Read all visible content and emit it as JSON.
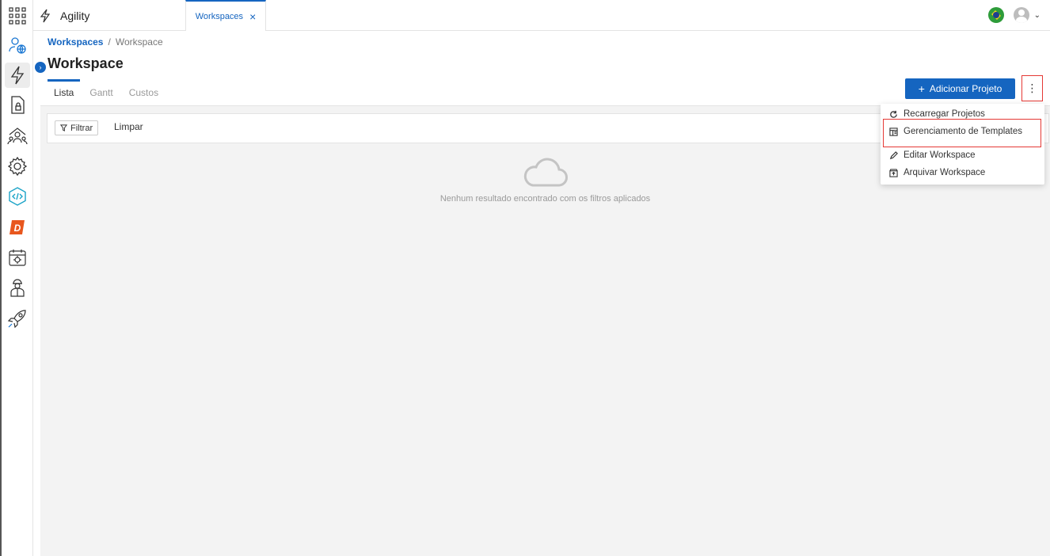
{
  "app": {
    "title": "Agility"
  },
  "topbar": {
    "tab_label": "Workspaces",
    "tab_close": "×",
    "user_chevron": "⌄"
  },
  "breadcrumb": {
    "root": "Workspaces",
    "separator": "/",
    "current": "Workspace"
  },
  "page": {
    "title": "Workspace",
    "collapse_glyph": "›"
  },
  "tabs": [
    {
      "label": "Lista"
    },
    {
      "label": "Gantt"
    },
    {
      "label": "Custos"
    }
  ],
  "actions": {
    "add_project": "Adicionar Projeto",
    "add_glyph": "+",
    "more_glyph": "⋮"
  },
  "filter": {
    "filter_label": "Filtrar",
    "clear_label": "Limpar"
  },
  "empty": {
    "message": "Nenhum resultado encontrado com os filtros aplicados"
  },
  "menu": {
    "items": [
      {
        "label": "Recarregar Projetos",
        "icon": "refresh-icon"
      },
      {
        "label": "Gerenciamento de Templates",
        "icon": "template-icon"
      },
      {
        "label": "Editar Workspace",
        "icon": "pencil-icon"
      },
      {
        "label": "Arquivar Workspace",
        "icon": "archive-icon"
      }
    ]
  },
  "sidebar": {
    "items": [
      {
        "icon": "apps-grid-icon"
      },
      {
        "icon": "user-globe-icon"
      },
      {
        "icon": "lightning-icon"
      },
      {
        "icon": "document-lock-icon"
      },
      {
        "icon": "team-icon"
      },
      {
        "icon": "settings-gear-icon"
      },
      {
        "icon": "code-hexagon-icon"
      },
      {
        "icon": "d-logo-icon"
      },
      {
        "icon": "calendar-gear-icon"
      },
      {
        "icon": "engineer-icon"
      },
      {
        "icon": "rocket-icon"
      }
    ]
  },
  "colors": {
    "accent": "#1565c0",
    "highlight": "#e53935",
    "content_bg": "#f3f3f3"
  }
}
